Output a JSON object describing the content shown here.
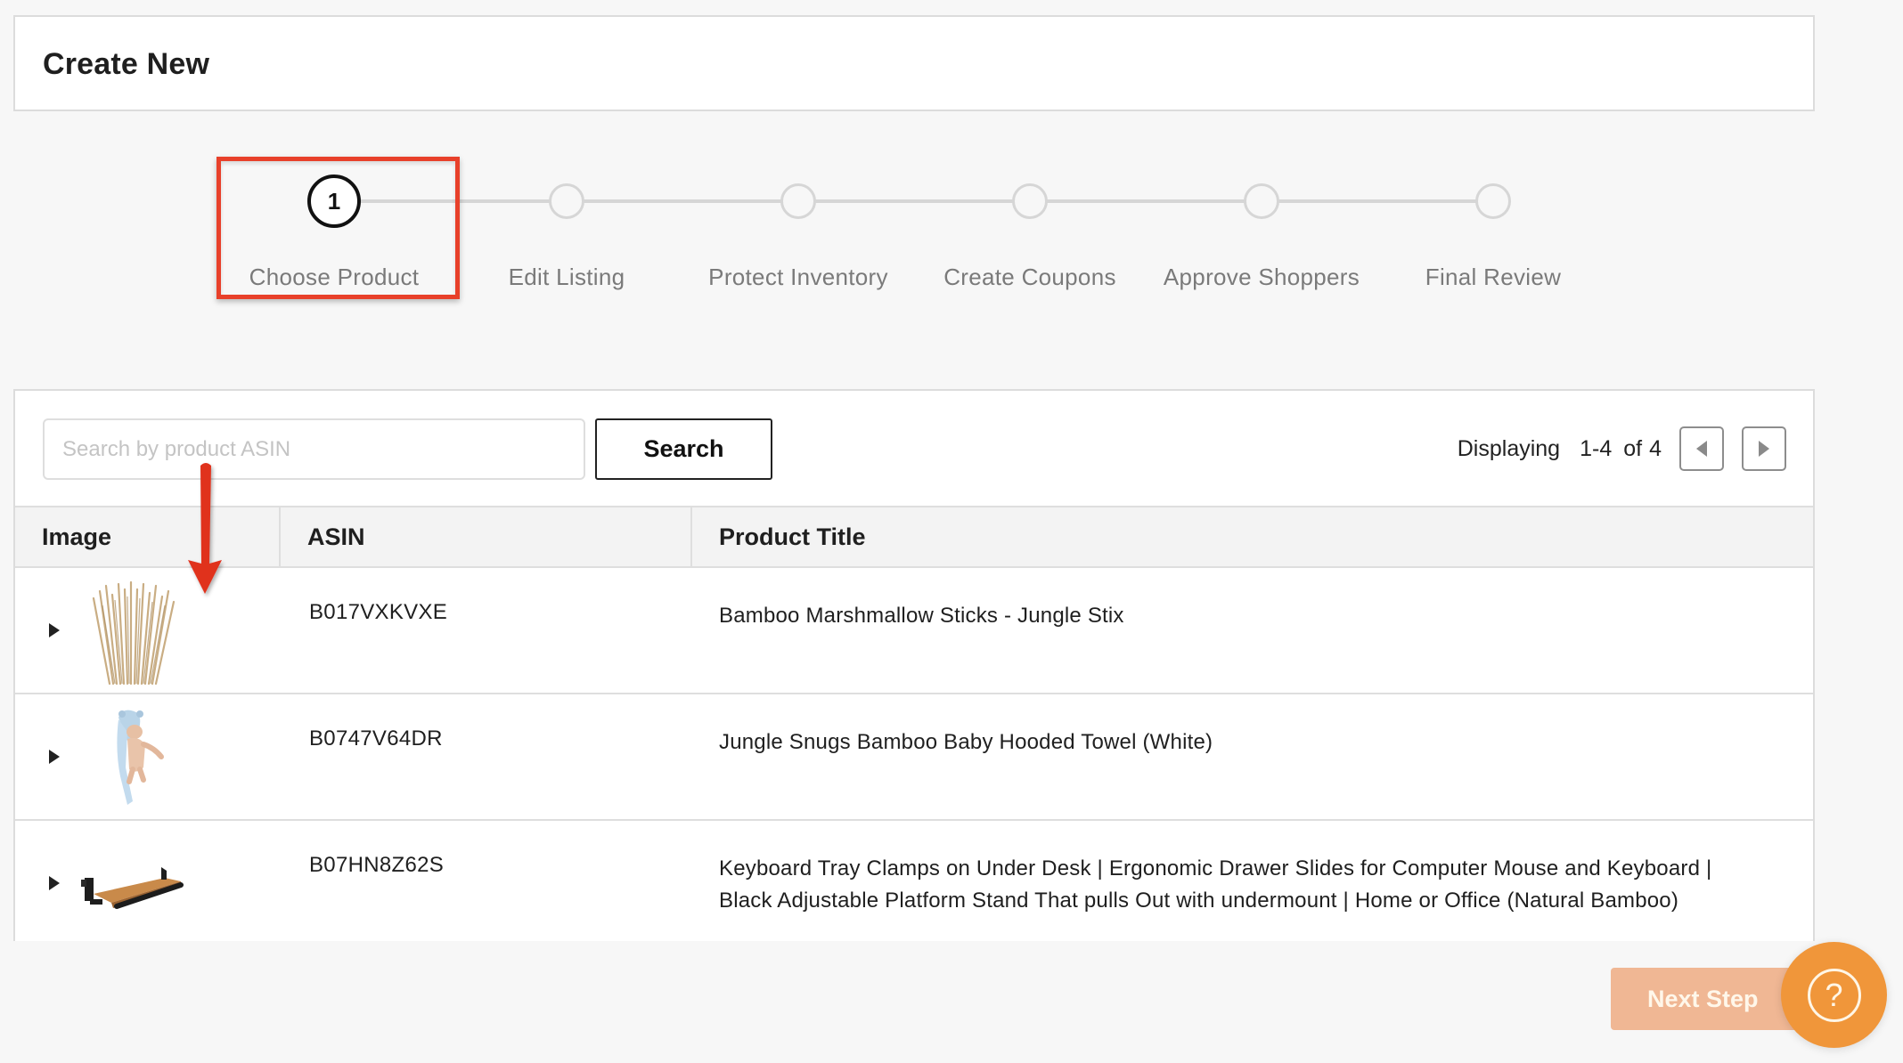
{
  "header": {
    "title": "Create New"
  },
  "stepper": {
    "active_index": 0,
    "steps": [
      {
        "number": "1",
        "label": "Choose Product"
      },
      {
        "number": "",
        "label": "Edit Listing"
      },
      {
        "number": "",
        "label": "Protect Inventory"
      },
      {
        "number": "",
        "label": "Create Coupons"
      },
      {
        "number": "",
        "label": "Approve Shoppers"
      },
      {
        "number": "",
        "label": "Final Review"
      }
    ]
  },
  "search": {
    "placeholder": "Search by product ASIN",
    "value": "",
    "button_label": "Search"
  },
  "pagination": {
    "prefix": "Displaying",
    "range": "1-4",
    "of_label": "of",
    "total": "4",
    "prev_icon": "triangle-left",
    "next_icon": "triangle-right"
  },
  "table": {
    "columns": [
      "Image",
      "ASIN",
      "Product Title"
    ],
    "rows": [
      {
        "image": "bamboo-sticks-bundle",
        "asin": "B017VXKVXE",
        "title_lines": [
          "Bamboo Marshmallow Sticks - Jungle Stix"
        ]
      },
      {
        "image": "baby-hooded-towel",
        "asin": "B0747V64DR",
        "title_lines": [
          "Jungle Snugs Bamboo Baby Hooded Towel (White)"
        ]
      },
      {
        "image": "keyboard-tray",
        "asin": "B07HN8Z62S",
        "title_lines": [
          "Keyboard Tray Clamps on Under Desk | Ergonomic Drawer Slides for Computer Mouse and Keyboard |",
          "Black Adjustable Platform Stand That pulls Out with undermount | Home or Office (Natural Bamboo)"
        ]
      }
    ]
  },
  "actions": {
    "next_step_label": "Next Step",
    "help_icon": "question-mark",
    "help_glyph": "?"
  },
  "annotations": {
    "highlight_color": "#e8402a",
    "arrow_color": "#e0331f"
  },
  "colors": {
    "accent_orange": "#f0963a",
    "next_disabled": "#f0b794",
    "page_bg": "#f7f7f7"
  }
}
